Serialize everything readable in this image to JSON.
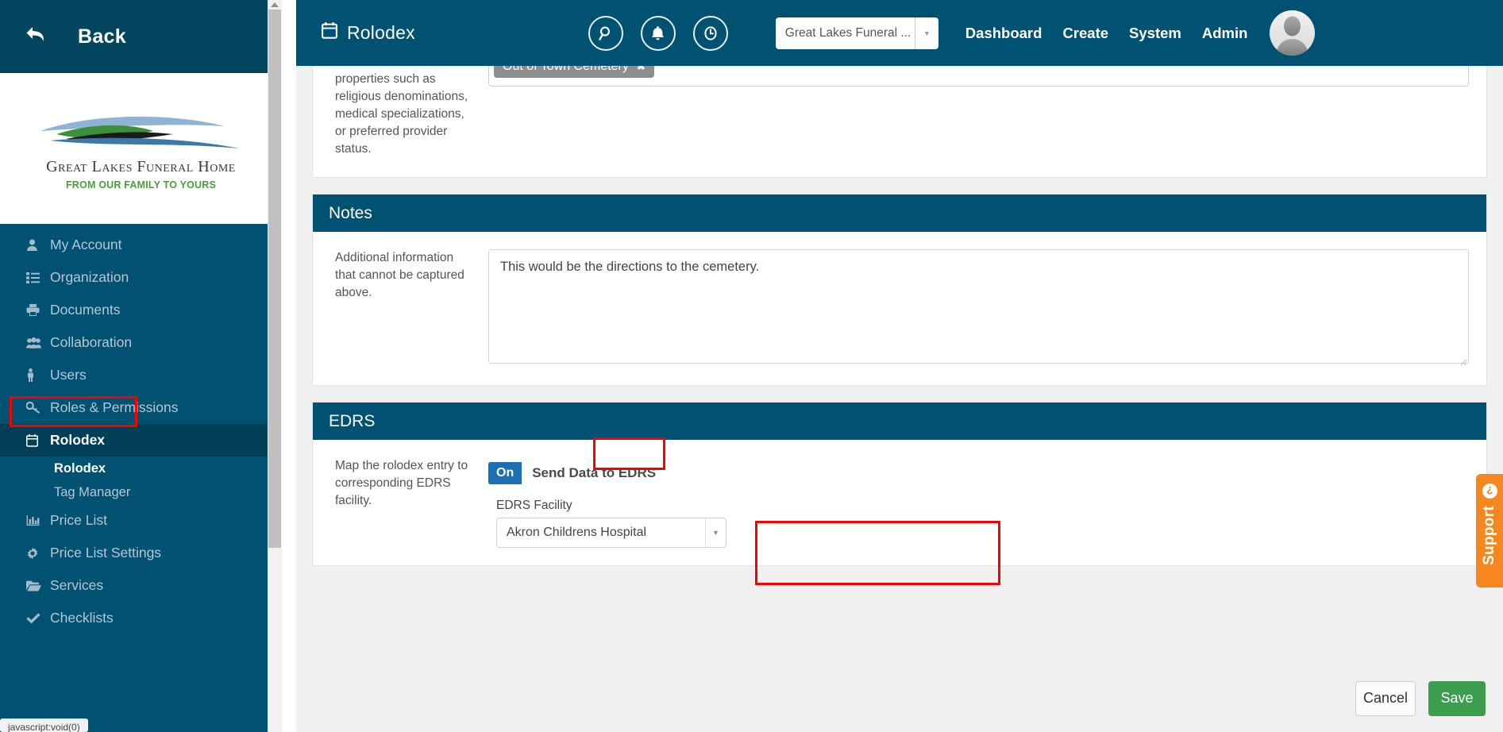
{
  "sidebar": {
    "back_label": "Back",
    "back_icon": "back-arrow-icon",
    "logo": {
      "name": "Great Lakes Funeral Home",
      "tagline": "FROM OUR FAMILY TO YOURS"
    },
    "items": [
      {
        "label": "My Account",
        "icon": "user-icon"
      },
      {
        "label": "Organization",
        "icon": "list-icon"
      },
      {
        "label": "Documents",
        "icon": "printer-icon"
      },
      {
        "label": "Collaboration",
        "icon": "group-icon"
      },
      {
        "label": "Users",
        "icon": "person-icon"
      },
      {
        "label": "Roles & Permissions",
        "icon": "key-icon"
      },
      {
        "label": "Rolodex",
        "icon": "calendar-icon",
        "active": true
      },
      {
        "label": "Price List",
        "icon": "bar-chart-icon"
      },
      {
        "label": "Price List Settings",
        "icon": "gear-icon"
      },
      {
        "label": "Services",
        "icon": "folder-open-icon"
      },
      {
        "label": "Checklists",
        "icon": "check-icon"
      }
    ],
    "subitems": [
      {
        "label": "Rolodex",
        "current": true
      },
      {
        "label": "Tag Manager",
        "current": false
      }
    ],
    "status_text": "javascript:void(0)"
  },
  "header": {
    "title": "Rolodex",
    "title_icon": "calendar-icon",
    "icon_buttons": [
      {
        "name": "search-icon"
      },
      {
        "name": "bell-icon"
      },
      {
        "name": "clock-icon"
      }
    ],
    "org_select": {
      "value": "Great Lakes Funeral ...",
      "caret": "▼"
    },
    "links": [
      "Dashboard",
      "Create",
      "System",
      "Admin"
    ],
    "avatar": "user-avatar"
  },
  "main": {
    "tags_card": {
      "helper": "properties such as religious denominations, medical specializations, or preferred provider status.",
      "chips": [
        {
          "label": "Out of Town Cemetery",
          "remove": "✖"
        }
      ]
    },
    "notes_card": {
      "title": "Notes",
      "helper": "Additional information that cannot be captured above.",
      "value": "This would be the directions to the cemetery.",
      "placeholder": ""
    },
    "edrs_card": {
      "title": "EDRS",
      "helper": "Map the rolodex entry to corresponding EDRS facility.",
      "toggle": {
        "state": "On",
        "label": "Send Data to EDRS"
      },
      "facility": {
        "label": "EDRS Facility",
        "value": "Akron Childrens Hospital",
        "caret": "▼"
      }
    }
  },
  "footer": {
    "cancel_label": "Cancel",
    "save_label": "Save"
  },
  "support_tab": {
    "label": "Support",
    "icon": "question-mark-icon"
  },
  "highlights": {
    "color": "#fb0000"
  },
  "colors": {
    "brand_dark": "#005172",
    "brand_darker": "#01455f",
    "accent_green": "#3c9e4d",
    "accent_orange": "#f6871f",
    "toggle_blue": "#1b6fb3"
  }
}
